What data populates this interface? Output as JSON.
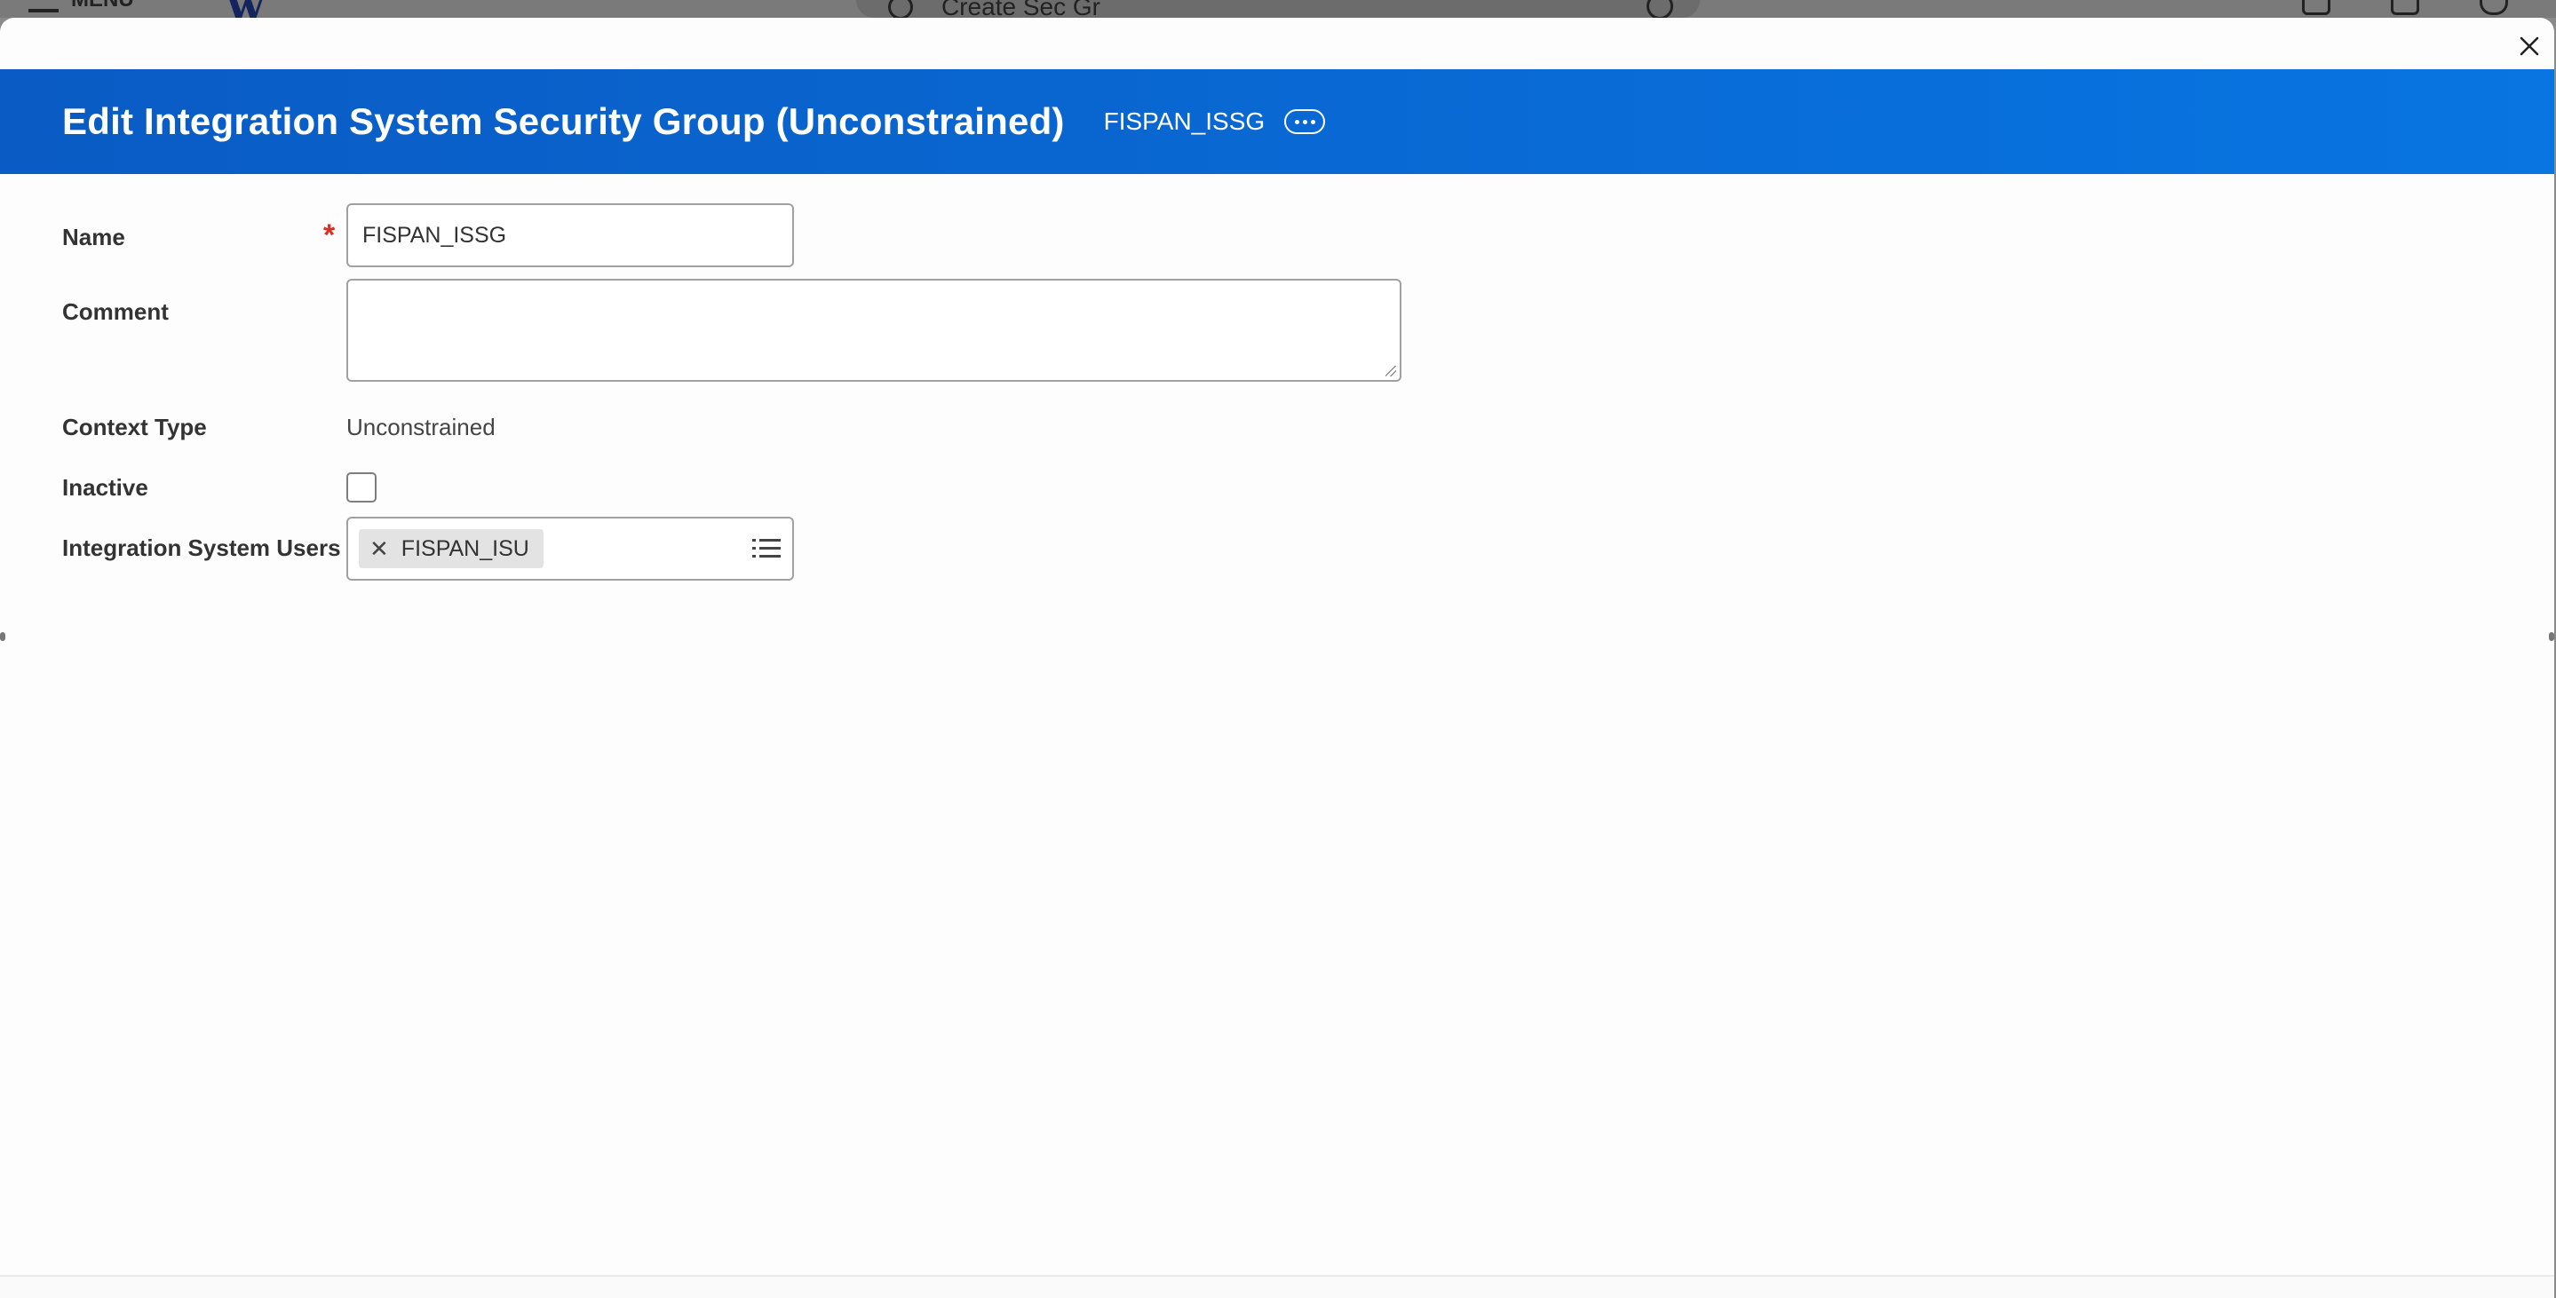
{
  "background": {
    "menu_label": "MENU",
    "logo": "w",
    "search_query": "Create Sec Gr"
  },
  "modal": {
    "title": "Edit Integration System Security Group (Unconstrained)",
    "subtitle": "FISPAN_ISSG",
    "close_icon": "close-icon",
    "more_icon": "more-options-icon",
    "header_color": "#0875e1"
  },
  "form": {
    "name": {
      "label": "Name",
      "value": "FISPAN_ISSG",
      "required": true
    },
    "comment": {
      "label": "Comment",
      "value": ""
    },
    "context_type": {
      "label": "Context Type",
      "value": "Unconstrained"
    },
    "inactive": {
      "label": "Inactive",
      "checked": false
    },
    "integration_system_users": {
      "label": "Integration System Users",
      "selected": [
        "FISPAN_ISU"
      ],
      "remove_icon": "remove-x-icon",
      "prompt_icon": "list-prompt-icon"
    }
  },
  "required_marker": "*"
}
